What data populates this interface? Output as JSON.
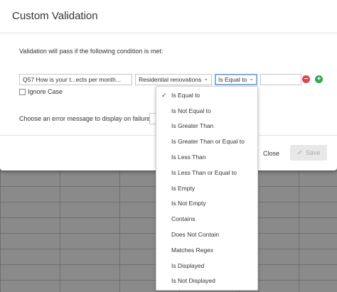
{
  "modal": {
    "title": "Custom Validation",
    "intro": "Validation will pass if the following condition is met:"
  },
  "condition": {
    "question": "Q57 How is your t...ects per month...",
    "choice": "Residential renovations",
    "operator": "Is Equal to",
    "value": "",
    "ignore_case_label": "Ignore Case",
    "ignore_case_checked": false
  },
  "error": {
    "label": "Choose an error message to display on failure:"
  },
  "footer": {
    "close_label": "Close",
    "save_label": "Save"
  },
  "operator_menu": {
    "selected_index": 0,
    "items": [
      {
        "label": "Is Equal to"
      },
      {
        "label": "Is Not Equal to"
      },
      {
        "label": "Is Greater Than"
      },
      {
        "label": "Is Greater Than or Equal to"
      },
      {
        "label": "Is Less Than"
      },
      {
        "label": "Is Less Than or Equal to"
      },
      {
        "label": "Is Empty"
      },
      {
        "label": "Is Not Empty"
      },
      {
        "label": "Contains"
      },
      {
        "label": "Does Not Contain"
      },
      {
        "label": "Matches Regex"
      },
      {
        "label": "Is Displayed"
      },
      {
        "label": "Is Not Displayed"
      }
    ]
  },
  "colors": {
    "remove": "#e0444a",
    "add": "#2fa84f",
    "overlay": "#8a8a8a"
  }
}
